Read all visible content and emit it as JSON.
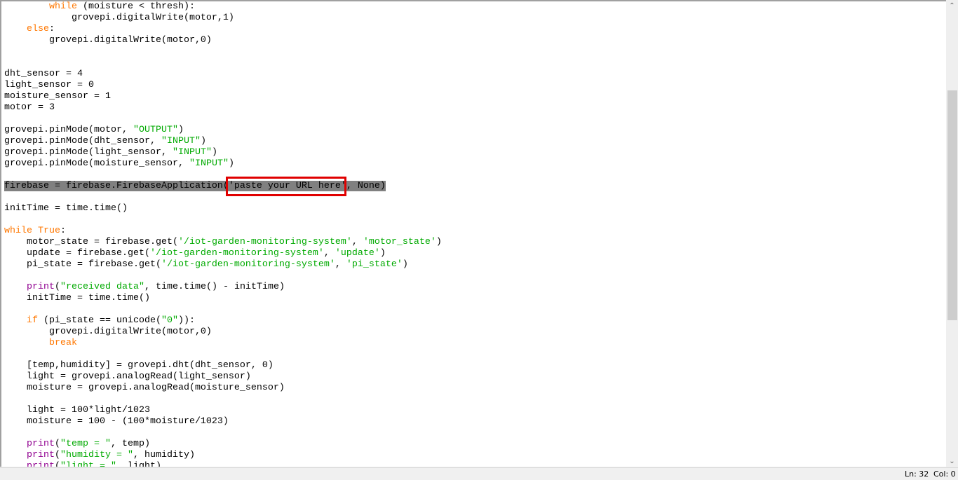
{
  "editor": {
    "lines": [
      [
        {
          "t": "        "
        },
        {
          "t": "while",
          "c": "kw"
        },
        {
          "t": " (moisture < thresh):"
        }
      ],
      [
        {
          "t": "            grovepi.digitalWrite(motor,1)"
        }
      ],
      [
        {
          "t": "    "
        },
        {
          "t": "else",
          "c": "kw"
        },
        {
          "t": ":"
        }
      ],
      [
        {
          "t": "        grovepi.digitalWrite(motor,0)"
        }
      ],
      [],
      [],
      [
        {
          "t": "dht_sensor = 4"
        }
      ],
      [
        {
          "t": "light_sensor = 0"
        }
      ],
      [
        {
          "t": "moisture_sensor = 1"
        }
      ],
      [
        {
          "t": "motor = 3"
        }
      ],
      [],
      [
        {
          "t": "grovepi.pinMode(motor, "
        },
        {
          "t": "\"OUTPUT\"",
          "c": "str"
        },
        {
          "t": ")"
        }
      ],
      [
        {
          "t": "grovepi.pinMode(dht_sensor, "
        },
        {
          "t": "\"INPUT\"",
          "c": "str"
        },
        {
          "t": ")"
        }
      ],
      [
        {
          "t": "grovepi.pinMode(light_sensor, "
        },
        {
          "t": "\"INPUT\"",
          "c": "str"
        },
        {
          "t": ")"
        }
      ],
      [
        {
          "t": "grovepi.pinMode(moisture_sensor, "
        },
        {
          "t": "\"INPUT\"",
          "c": "str"
        },
        {
          "t": ")"
        }
      ],
      [],
      [
        {
          "t": "firebase = firebase.FirebaseApplication('paste your URL here', None)",
          "c": "sel"
        }
      ],
      [],
      [
        {
          "t": "initTime = time.time()"
        }
      ],
      [],
      [
        {
          "t": "while True",
          "c": "kw"
        },
        {
          "t": ":"
        }
      ],
      [
        {
          "t": "    motor_state = firebase.get("
        },
        {
          "t": "'/iot-garden-monitoring-system'",
          "c": "str"
        },
        {
          "t": ", "
        },
        {
          "t": "'motor_state'",
          "c": "str"
        },
        {
          "t": ")"
        }
      ],
      [
        {
          "t": "    update = firebase.get("
        },
        {
          "t": "'/iot-garden-monitoring-system'",
          "c": "str"
        },
        {
          "t": ", "
        },
        {
          "t": "'update'",
          "c": "str"
        },
        {
          "t": ")"
        }
      ],
      [
        {
          "t": "    pi_state = firebase.get("
        },
        {
          "t": "'/iot-garden-monitoring-system'",
          "c": "str"
        },
        {
          "t": ", "
        },
        {
          "t": "'pi_state'",
          "c": "str"
        },
        {
          "t": ")"
        }
      ],
      [],
      [
        {
          "t": "    "
        },
        {
          "t": "print",
          "c": "bi"
        },
        {
          "t": "("
        },
        {
          "t": "\"received data\"",
          "c": "str"
        },
        {
          "t": ", time.time() - initTime)"
        }
      ],
      [
        {
          "t": "    initTime = time.time()"
        }
      ],
      [],
      [
        {
          "t": "    "
        },
        {
          "t": "if",
          "c": "kw"
        },
        {
          "t": " (pi_state == unicode("
        },
        {
          "t": "\"0\"",
          "c": "str"
        },
        {
          "t": ")):"
        }
      ],
      [
        {
          "t": "        grovepi.digitalWrite(motor,0)"
        }
      ],
      [
        {
          "t": "        "
        },
        {
          "t": "break",
          "c": "kw"
        }
      ],
      [],
      [
        {
          "t": "    [temp,humidity] = grovepi.dht(dht_sensor, 0)"
        }
      ],
      [
        {
          "t": "    light = grovepi.analogRead(light_sensor)"
        }
      ],
      [
        {
          "t": "    moisture = grovepi.analogRead(moisture_sensor)"
        }
      ],
      [],
      [
        {
          "t": "    light = 100*light/1023"
        }
      ],
      [
        {
          "t": "    moisture = 100 - (100*moisture/1023)"
        }
      ],
      [],
      [
        {
          "t": "    "
        },
        {
          "t": "print",
          "c": "bi"
        },
        {
          "t": "("
        },
        {
          "t": "\"temp = \"",
          "c": "str"
        },
        {
          "t": ", temp)"
        }
      ],
      [
        {
          "t": "    "
        },
        {
          "t": "print",
          "c": "bi"
        },
        {
          "t": "("
        },
        {
          "t": "\"humidity = \"",
          "c": "str"
        },
        {
          "t": ", humidity)"
        }
      ],
      [
        {
          "t": "    "
        },
        {
          "t": "print",
          "c": "bi"
        },
        {
          "t": "("
        },
        {
          "t": "\"light = \"",
          "c": "str"
        },
        {
          "t": ", light)"
        }
      ]
    ],
    "highlight_annotation": "red-box-around-url-placeholder"
  },
  "scrollbar": {
    "up_icon": "chevron-up-icon",
    "down_icon": "chevron-down-icon",
    "up_glyph": "⌃",
    "down_glyph": "⌄",
    "position_fraction": 0.19
  },
  "status": {
    "line": "Ln: 32",
    "col": "Col: 0"
  }
}
